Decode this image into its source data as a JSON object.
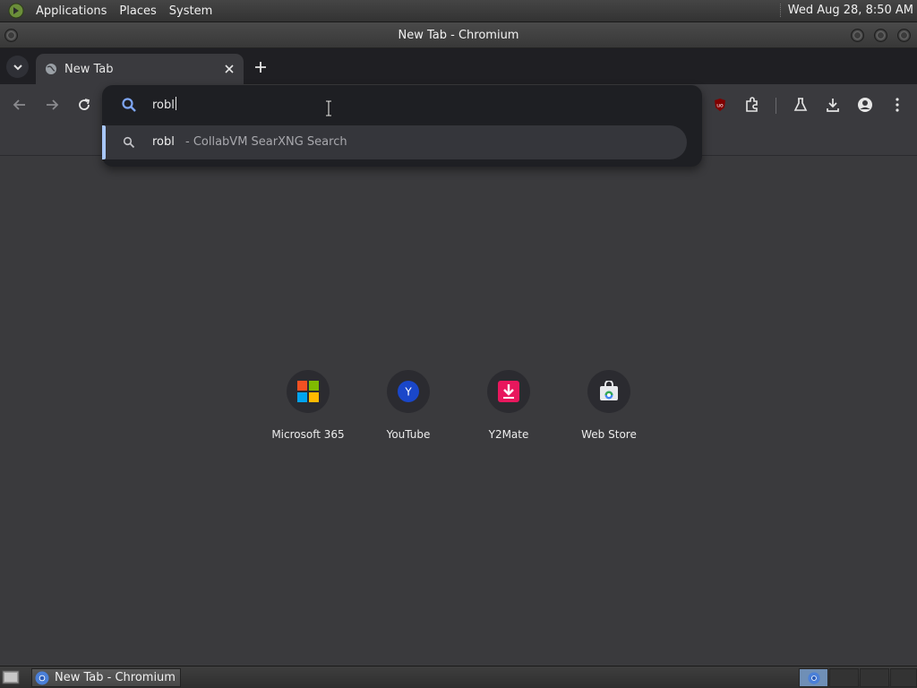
{
  "top_panel": {
    "menus": [
      "Applications",
      "Places",
      "System"
    ],
    "clock": "Wed Aug 28,  8:50 AM"
  },
  "window": {
    "title": "New Tab - Chromium"
  },
  "tab": {
    "title": "New Tab"
  },
  "omnibox": {
    "input_value": "robl",
    "suggestion": {
      "query": "robl",
      "source": " - CollabVM SearXNG Search"
    }
  },
  "shortcuts": [
    {
      "label": "Microsoft 365",
      "icon": "microsoft-365-icon"
    },
    {
      "label": "YouTube",
      "icon": "youtube-icon",
      "letter": "Y"
    },
    {
      "label": "Y2Mate",
      "icon": "y2mate-icon"
    },
    {
      "label": "Web Store",
      "icon": "web-store-icon"
    }
  ],
  "taskbar": {
    "task_label": "New Tab - Chromium"
  },
  "colors": {
    "accent_blue": "#a8c7fa",
    "page_bg": "#3a3a3e",
    "omnibox_bg": "#1e1f23",
    "ublock_red": "#800000"
  },
  "icons": [
    "search-icon",
    "back-icon",
    "forward-icon",
    "reload-icon",
    "ublock-icon",
    "extensions-icon",
    "labs-icon",
    "download-icon",
    "profile-icon",
    "menu-icon"
  ]
}
